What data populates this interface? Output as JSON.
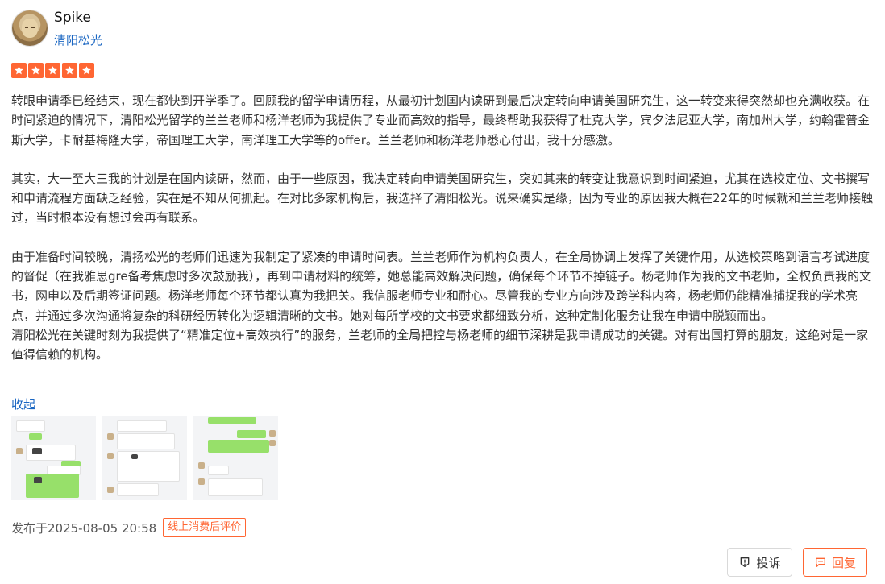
{
  "user": {
    "name": "Spike",
    "shop": "清阳松光"
  },
  "rating": {
    "stars": 5,
    "max": 5,
    "color": "#ff6633"
  },
  "review": {
    "paragraphs": [
      "转眼申请季已经结束，现在都快到开学季了。回顾我的留学申请历程，从最初计划国内读研到最后决定转向申请美国研究生，这一转变来得突然却也充满收获。在时间紧迫的情况下，清阳松光留学的兰兰老师和杨洋老师为我提供了专业而高效的指导，最终帮助我获得了杜克大学，宾夕法尼亚大学，南加州大学，约翰霍普金斯大学，卡耐基梅隆大学，帝国理工大学，南洋理工大学等的offer。兰兰老师和杨洋老师悉心付出，我十分感激。",
      "其实，大一至大三我的计划是在国内读研，然而，由于一些原因，我决定转向申请美国研究生，突如其来的转变让我意识到时间紧迫，尤其在选校定位、文书撰写和申请流程方面缺乏经验，实在是不知从何抓起。在对比多家机构后，我选择了清阳松光。说来确实是缘，因为专业的原因我大概在22年的时候就和兰兰老师接触过，当时根本没有想过会再有联系。",
      "由于准备时间较晚，清扬松光的老师们迅速为我制定了紧凑的申请时间表。兰兰老师作为机构负责人，在全局协调上发挥了关键作用，从选校策略到语言考试进度的督促（在我雅思gre备考焦虑时多次鼓励我），再到申请材料的统筹，她总能高效解决问题，确保每个环节不掉链子。杨老师作为我的文书老师，全权负责我的文书，网申以及后期签证问题。杨洋老师每个环节都认真为我把关。我信服老师专业和耐心。尽管我的专业方向涉及跨学科内容，杨老师仍能精准捕捉我的学术亮点，并通过多次沟通将复杂的科研经历转化为逻辑清晰的文书。她对每所学校的文书要求都细致分析，这种定制化服务让我在申请中脱颖而出。",
      "清阳松光在关键时刻为我提供了“精准定位+高效执行”的服务，兰老师的全局把控与杨老师的细节深耕是我申请成功的关键。对有出国打算的朋友，这绝对是一家值得信赖的机构。"
    ],
    "collapse_label": "收起"
  },
  "images": [
    {
      "name": "chat-screenshot-1"
    },
    {
      "name": "chat-screenshot-2"
    },
    {
      "name": "chat-screenshot-3"
    }
  ],
  "footer": {
    "published": "发布于2025-08-05 20:58",
    "tag": "线上消费后评价"
  },
  "actions": {
    "report": "投诉",
    "reply": "回复"
  }
}
